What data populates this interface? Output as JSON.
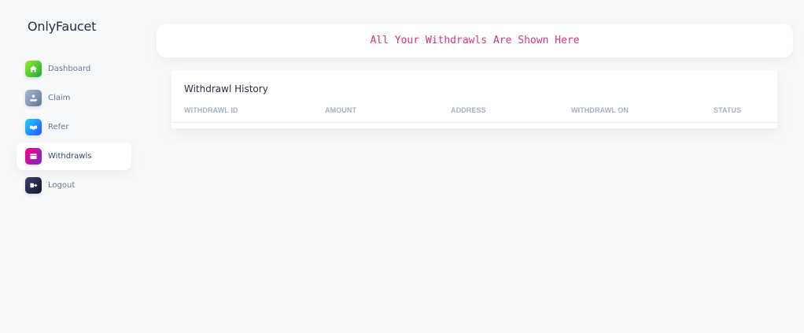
{
  "brand": {
    "name": "OnlyFaucet"
  },
  "sidebar": {
    "items": [
      {
        "label": "Dashboard",
        "icon": "home-icon",
        "color": "#82d616",
        "active": false
      },
      {
        "label": "Claim",
        "icon": "hand-coin-icon",
        "color": "#8392ab",
        "active": false
      },
      {
        "label": "Refer",
        "icon": "handshake-icon",
        "color": "#17c1e8",
        "active": false
      },
      {
        "label": "Withdrawls",
        "icon": "wallet-icon",
        "color": "#cb0c9f",
        "active": true
      },
      {
        "label": "Logout",
        "icon": "logout-icon",
        "color": "#252f40",
        "active": false
      }
    ]
  },
  "banner": {
    "text": "All Your Withdrawls Are Shown Here",
    "color": "#d63384"
  },
  "history": {
    "title": "Withdrawl History",
    "columns": [
      "WITHDRAWL ID",
      "AMOUNT",
      "ADDRESS",
      "WITHDRAWL ON",
      "STATUS"
    ],
    "rows": []
  }
}
